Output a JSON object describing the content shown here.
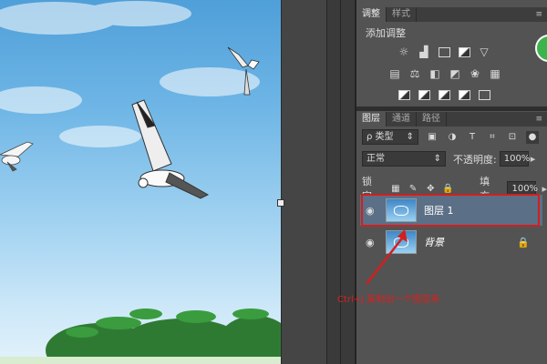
{
  "colors": {
    "accent": "#d21f1f",
    "panel": "#535353",
    "green_icon": "#3cb44b"
  },
  "adjust_tabs": [
    {
      "label": "调整"
    },
    {
      "label": "样式"
    }
  ],
  "adjust_title": "添加调整",
  "adjust_icons_row1": [
    "brightness-icon",
    "levels-icon",
    "curves-icon",
    "exposure-icon",
    "vibrance-icon"
  ],
  "adjust_icons_row2": [
    "hue-saturation-icon",
    "color-balance-icon",
    "black-white-icon",
    "photo-filter-icon",
    "channel-mixer-icon",
    "color-lookup-icon"
  ],
  "adjust_icons_row3": [
    "invert-icon",
    "posterize-icon",
    "threshold-icon",
    "gradient-map-icon",
    "selective-color-icon"
  ],
  "layers_tabs": [
    {
      "label": "图层"
    },
    {
      "label": "通道"
    },
    {
      "label": "路径"
    }
  ],
  "filter": {
    "label": "ρ 类型"
  },
  "blend_mode": "正常",
  "opacity": {
    "label": "不透明度:",
    "value": "100%"
  },
  "lock": {
    "label": "锁定:"
  },
  "fill": {
    "label": "填充:",
    "value": "100%"
  },
  "layers": [
    {
      "name": "图层 1",
      "selected": true
    },
    {
      "name": "背景",
      "selected": false
    }
  ],
  "annotation": "Ctrl+J 复制出一个图层来"
}
